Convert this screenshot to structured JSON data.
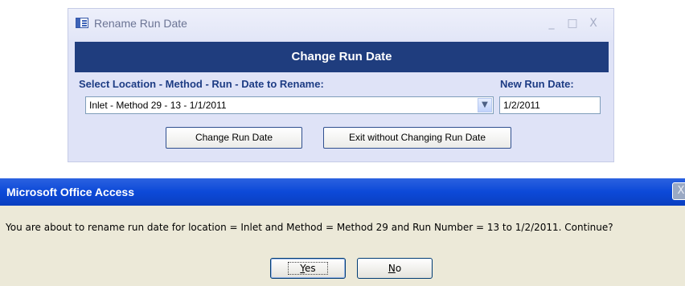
{
  "form": {
    "title": "Rename Run Date",
    "controls": {
      "minimize": "_",
      "maximize": "□",
      "close": "X"
    },
    "header": "Change Run Date",
    "select_label": "Select Location - Method - Run - Date to Rename:",
    "new_date_label": "New Run Date:",
    "combo_value": "Inlet - Method 29  - 13 - 1/1/2011",
    "new_date_value": "1/2/2011",
    "change_button": "Change Run Date",
    "exit_button": "Exit without Changing Run Date"
  },
  "dialog": {
    "title": "Microsoft Office Access",
    "message": "You are about to rename run date for location = Inlet and Method = Method 29  and Run Number = 13 to 1/2/2011.  Continue?",
    "yes_first": "Y",
    "yes_rest": "es",
    "no_first": "N",
    "no_rest": "o",
    "close": "X"
  },
  "icons": {
    "form_icon": "form-icon",
    "dropdown": "chevron-down-icon",
    "close": "close-icon"
  },
  "colors": {
    "header_bg": "#1f3d7e",
    "label_text": "#1d3c84",
    "form_bg": "#dfe3f7",
    "dialog_title_bg": "#0c49d8",
    "dialog_bg": "#ece9d8"
  }
}
